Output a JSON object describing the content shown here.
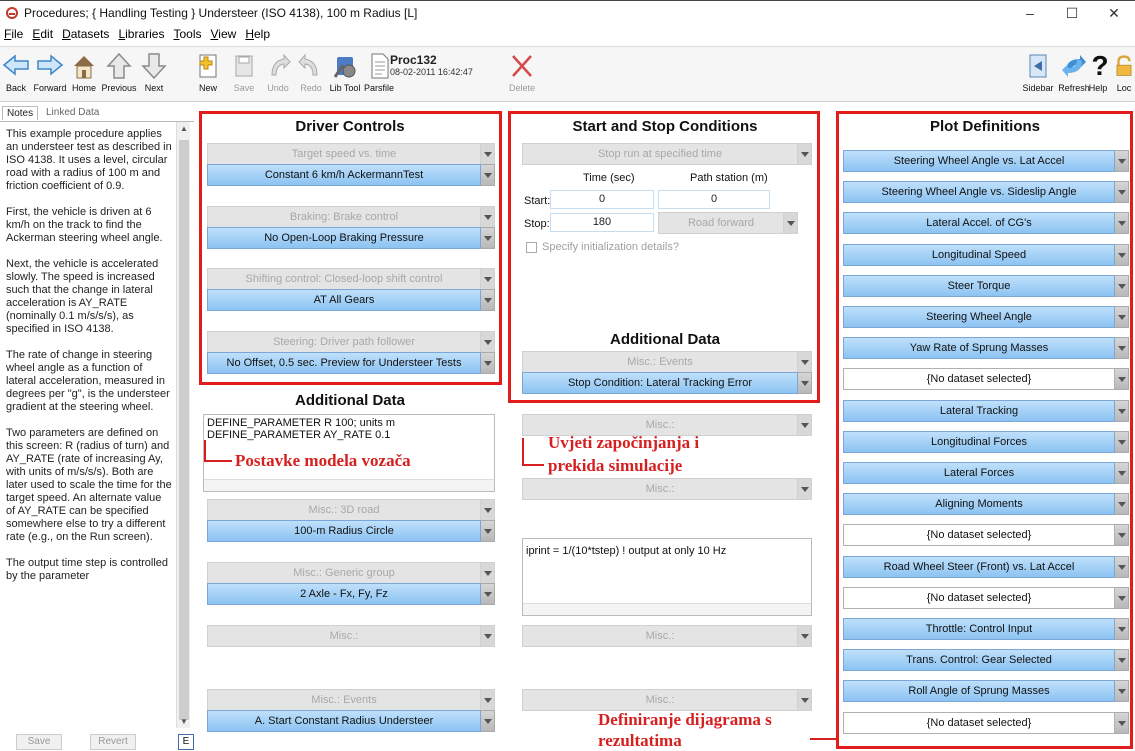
{
  "window": {
    "title": "Procedures;  { Handling Testing }  Understeer (ISO 4138), 100 m Radius [L]",
    "minimize": "–",
    "maximize": "☐",
    "close": "✕"
  },
  "menu": [
    "File",
    "Edit",
    "Datasets",
    "Libraries",
    "Tools",
    "View",
    "Help"
  ],
  "toolbar": {
    "back": "Back",
    "forward": "Forward",
    "home": "Home",
    "previous": "Previous",
    "next": "Next",
    "new": "New",
    "save": "Save",
    "undo": "Undo",
    "redo": "Redo",
    "lib_tool": "Lib Tool",
    "parsfile": "Parsfile",
    "file_name": "Proc132",
    "file_date": "08-02-2011 16:42:47",
    "delete": "Delete",
    "sidebar": "Sidebar",
    "refresh": "Refresh",
    "help": "Help",
    "lock": "Loc"
  },
  "notes": {
    "tabs": [
      "Notes",
      "Linked Data"
    ],
    "paragraphs": [
      "This example procedure applies an understeer test as described in ISO 4138. It uses a level, circular road with a radius of 100 m and friction coefficient of 0.9.",
      "First, the vehicle is driven at 6 km/h on the track to find the Ackerman steering wheel angle.",
      "Next, the vehicle is accelerated slowly. The speed is increased such that the change in lateral acceleration is AY_RATE (nominally 0.1 m/s/s/s), as specified in ISO 4138.",
      "The rate of change in steering wheel angle as a function of lateral acceleration, measured in degrees per \"g\", is the understeer gradient at the steering wheel.",
      "Two parameters are defined on this screen: R (radius of turn) and AY_RATE (rate of increasing Ay, with units of m/s/s/s). Both are later used to scale the time for the target speed. An alternate value of AY_RATE can be specified somewhere else to try a different rate (e.g., on the Run screen).",
      "The output time step is controlled by the parameter"
    ],
    "save": "Save",
    "revert": "Revert",
    "edit": "E"
  },
  "driver": {
    "title": "Driver Controls",
    "items": [
      {
        "label": "Target speed vs. time",
        "value": "Constant 6 km/h AckermannTest"
      },
      {
        "label": "Braking: Brake control",
        "value": "No Open-Loop Braking Pressure"
      },
      {
        "label": "Shifting control: Closed-loop shift control",
        "value": "AT All Gears"
      },
      {
        "label": "Steering: Driver path follower",
        "value": "No Offset, 0.5 sec. Preview for Understeer Tests"
      }
    ]
  },
  "additional_left": {
    "title": "Additional Data",
    "text_lines": [
      "DEFINE_PARAMETER R 100; units m",
      "DEFINE_PARAMETER AY_RATE 0.1"
    ],
    "items": [
      {
        "label": "Misc.: 3D road",
        "value": "100-m Radius Circle"
      },
      {
        "label": "Misc.: Generic group",
        "value": "2 Axle - Fx, Fy, Fz"
      },
      {
        "label": "Misc.:"
      },
      {
        "label": "Misc.: Events",
        "value": "A. Start Constant Radius Understeer"
      }
    ]
  },
  "startstop": {
    "title": "Start and Stop Conditions",
    "stop_run": "Stop run at specified time",
    "col_time": "Time (sec)",
    "col_station": "Path station (m)",
    "start_label": "Start:",
    "start_time": "0",
    "start_station": "0",
    "stop_label": "Stop:",
    "stop_time": "180",
    "stop_station": "Road forward",
    "init_details": "Specify initialization details?",
    "additional_title": "Additional Data",
    "events_label": "Misc.: Events",
    "events_value": "Stop Condition: Lateral Tracking Error",
    "misc1": "Misc.:",
    "misc2": "Misc.:",
    "iprint": "iprint = 1/(10*tstep) ! output at only 10 Hz",
    "misc3": "Misc.:",
    "misc4": "Misc.:"
  },
  "plots": {
    "title": "Plot Definitions",
    "items": [
      {
        "value": "Steering Wheel Angle vs. Lat Accel",
        "selected": true
      },
      {
        "value": "Steering Wheel Angle vs. Sideslip Angle",
        "selected": true
      },
      {
        "value": "Lateral Accel. of CG's",
        "selected": true
      },
      {
        "value": "Longitudinal Speed",
        "selected": true
      },
      {
        "value": "Steer Torque",
        "selected": true
      },
      {
        "value": "Steering Wheel Angle",
        "selected": true
      },
      {
        "value": "Yaw Rate of Sprung Masses",
        "selected": true
      },
      {
        "value": "{No dataset selected}",
        "selected": false
      },
      {
        "value": "Lateral Tracking",
        "selected": true
      },
      {
        "value": "Longitudinal Forces",
        "selected": true
      },
      {
        "value": "Lateral Forces",
        "selected": true
      },
      {
        "value": "Aligning Moments",
        "selected": true
      },
      {
        "value": "{No dataset selected}",
        "selected": false
      },
      {
        "value": "Road Wheel Steer (Front) vs. Lat Accel",
        "selected": true
      },
      {
        "value": "{No dataset selected}",
        "selected": false
      },
      {
        "value": "Throttle: Control Input",
        "selected": true
      },
      {
        "value": "Trans. Control: Gear Selected",
        "selected": true
      },
      {
        "value": "Roll Angle of Sprung Masses",
        "selected": true
      },
      {
        "value": "{No dataset selected}",
        "selected": false
      }
    ]
  },
  "annotations": {
    "driver": "Postavke modela vozača",
    "startstop_line1": "Uvjeti započinjanja i",
    "startstop_line2": "prekida simulacije",
    "plots_line1": "Definiranje dijagrama s",
    "plots_line2": "rezultatima",
    "color": "#d61f1f"
  }
}
